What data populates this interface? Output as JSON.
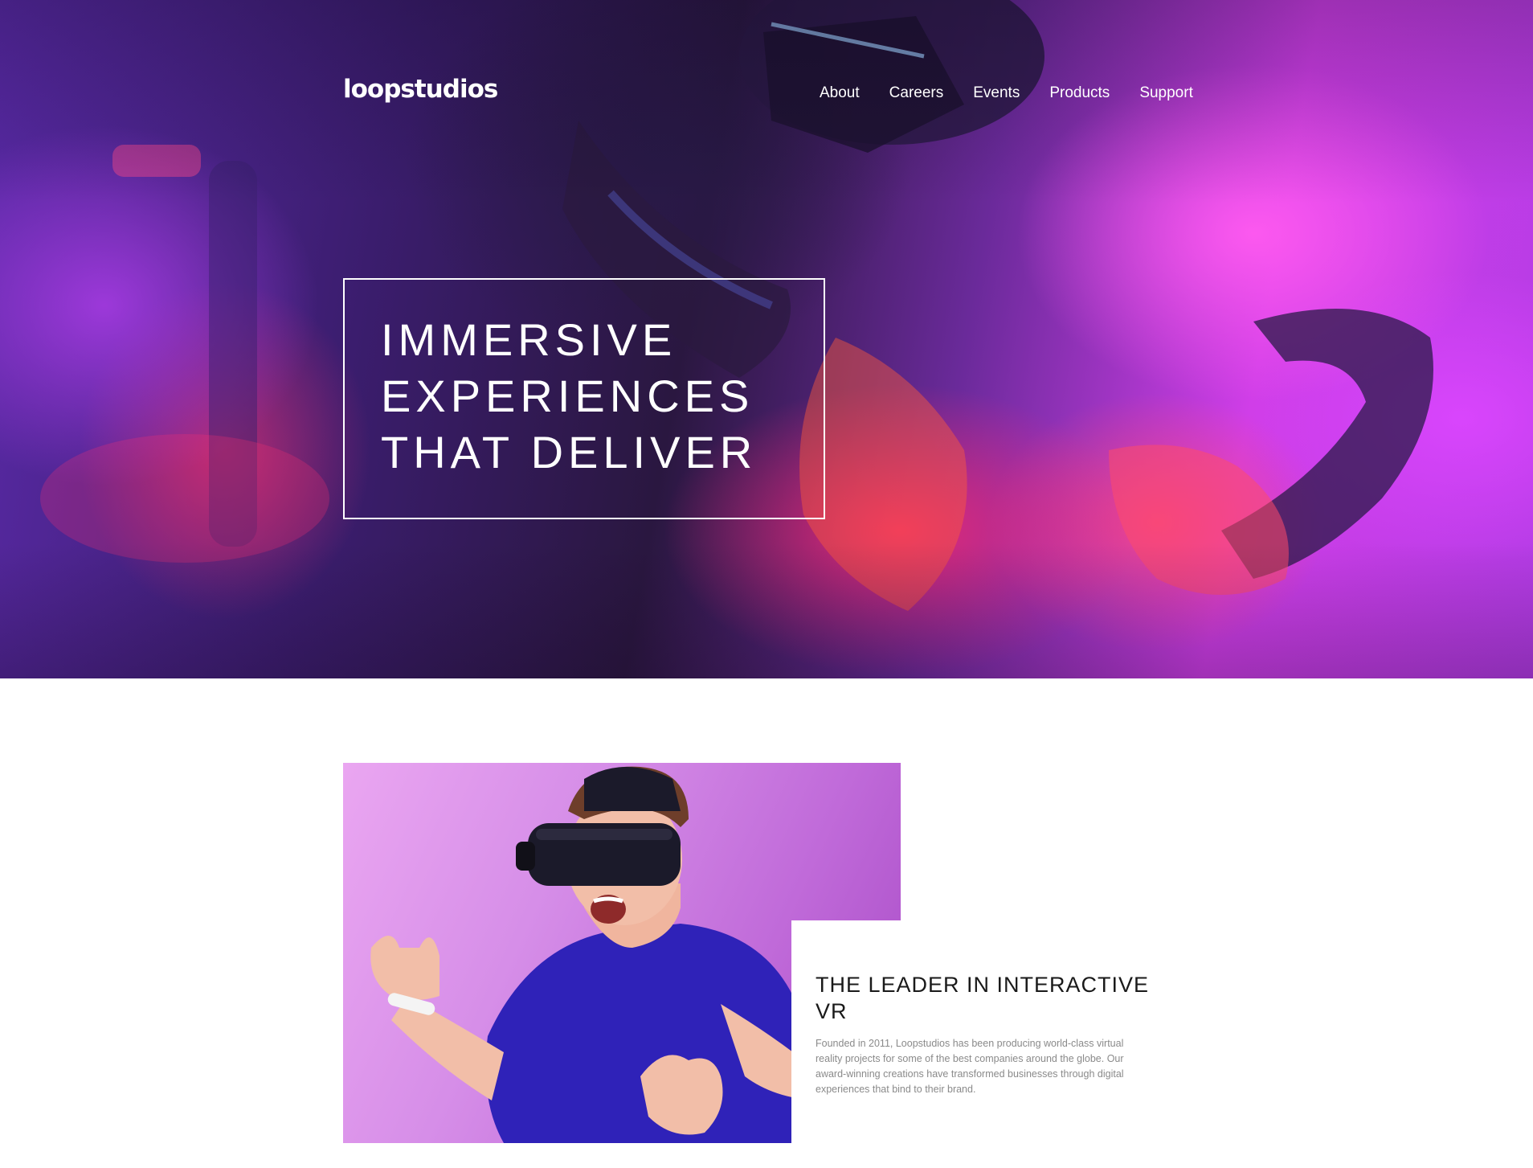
{
  "header": {
    "logo": "loopstudios",
    "nav": [
      {
        "label": "About"
      },
      {
        "label": "Careers"
      },
      {
        "label": "Events"
      },
      {
        "label": "Products"
      },
      {
        "label": "Support"
      }
    ]
  },
  "hero": {
    "title_lines": [
      "IMMERSIVE",
      "EXPERIENCES",
      "THAT DELIVER"
    ]
  },
  "intro": {
    "title": "THE LEADER IN INTERACTIVE VR",
    "text": "Founded in 2011, Loopstudios has been producing world-class virtual reality projects for some of the best companies around the globe. Our award-winning creations have transformed businesses through digital experiences that bind to their brand."
  }
}
